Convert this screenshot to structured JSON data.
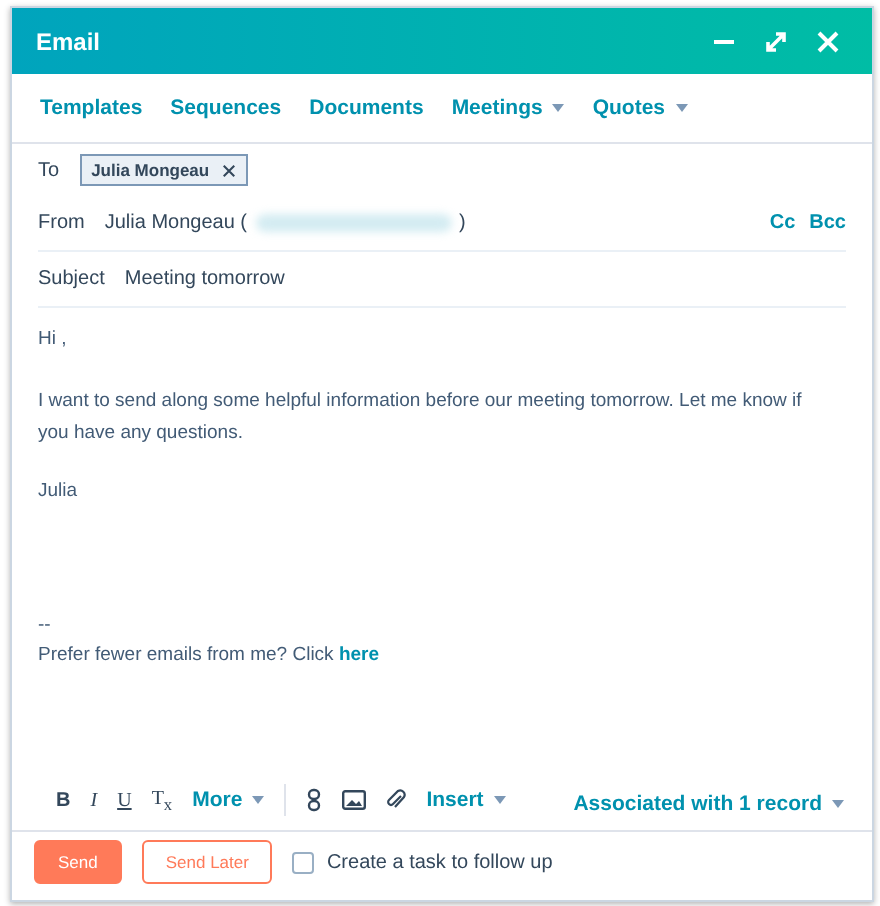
{
  "window": {
    "title": "Email"
  },
  "tabs": [
    {
      "label": "Templates",
      "kind": "link"
    },
    {
      "label": "Sequences",
      "kind": "link"
    },
    {
      "label": "Documents",
      "kind": "link"
    },
    {
      "label": "Meetings",
      "kind": "dropdown"
    },
    {
      "label": "Quotes",
      "kind": "dropdown"
    }
  ],
  "to": {
    "label": "To",
    "recipients": [
      "Julia Mongeau"
    ]
  },
  "from": {
    "label": "From",
    "name_before": "Julia Mongeau (",
    "name_after": ")",
    "cc": "Cc",
    "bcc": "Bcc"
  },
  "subject": {
    "label": "Subject",
    "value": "Meeting tomorrow"
  },
  "body": {
    "greeting": "Hi ,",
    "paragraph": "I want to send along some helpful information before our meeting tomorrow. Let me know if you have any questions.",
    "signoff": "Julia",
    "separator": "--",
    "unsubscribe": "Prefer fewer emails from me? Click ",
    "unsubscribe_link": "here"
  },
  "toolbar": {
    "format": [
      {
        "label": "B",
        "kind": "bold"
      },
      {
        "label": "I",
        "kind": "italic"
      },
      {
        "label": "U",
        "kind": "underline"
      },
      {
        "label": "T$_{x}$",
        "kind": "clear"
      }
    ],
    "more": "More",
    "insert": "Insert",
    "associated": "Associated with 1 record"
  },
  "footer": {
    "send": "Send",
    "send_later": "Send Later",
    "task": {
      "label": "Create a task to follow up",
      "checked": false
    }
  }
}
